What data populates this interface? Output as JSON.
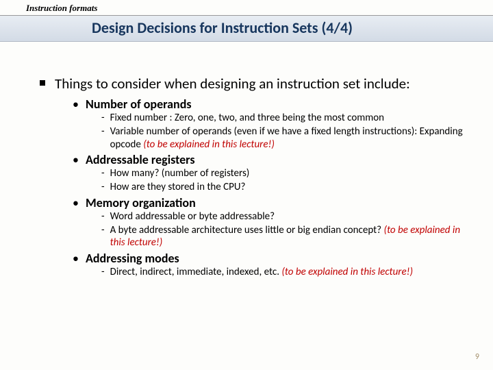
{
  "header": {
    "breadcrumb": "Instruction formats",
    "title": "Design Decisions for Instruction Sets (4/4)"
  },
  "main": {
    "lead": "Things to consider when designing an instruction set include:",
    "items": [
      {
        "label": "Number of operands",
        "points": [
          {
            "pre": "Fixed number : Zero, one, two, and three being the most common",
            "red": ""
          },
          {
            "pre": "Variable number of operands (even if we have a fixed length instructions): Expanding opcode ",
            "red": "(to be explained in this lecture!)"
          }
        ]
      },
      {
        "label": "Addressable registers",
        "points": [
          {
            "pre": "How many? (number of registers)",
            "red": ""
          },
          {
            "pre": "How are they stored in the CPU?",
            "red": ""
          }
        ]
      },
      {
        "label": "Memory organization",
        "points": [
          {
            "pre": "Word addressable or byte addressable?",
            "red": ""
          },
          {
            "pre": "A byte addressable architecture uses little or big endian concept? ",
            "red": "(to be explained in this lecture!)"
          }
        ]
      },
      {
        "label": "Addressing modes",
        "points": [
          {
            "pre": "Direct, indirect, immediate, indexed, etc. ",
            "red": "(to be explained in this lecture!)"
          }
        ]
      }
    ]
  },
  "pagenum": "9"
}
